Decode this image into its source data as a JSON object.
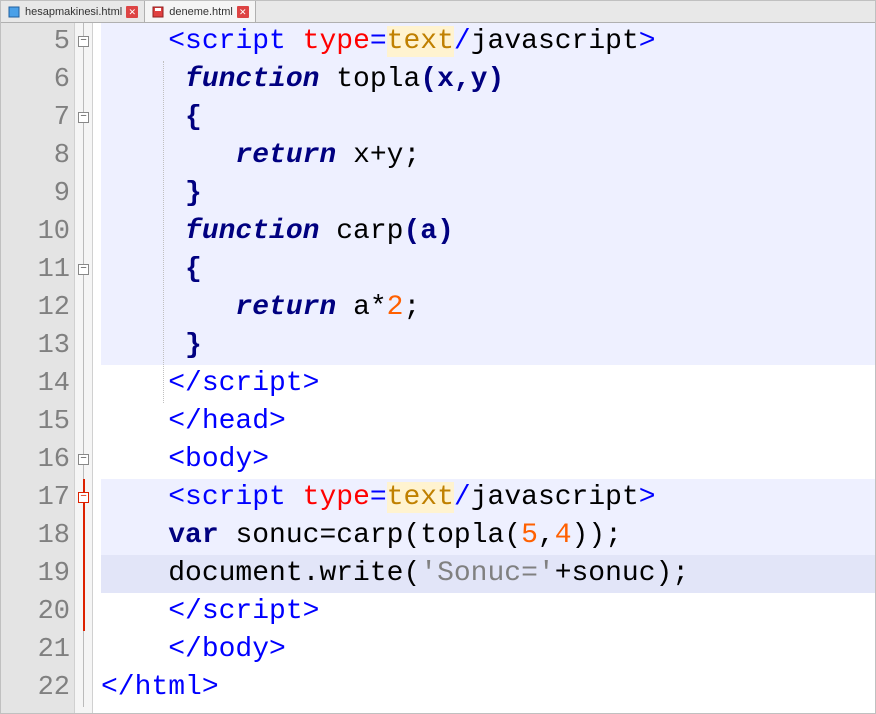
{
  "tabs": [
    {
      "label": "hesapmakinesi.html",
      "active": false,
      "icon": "file-blue"
    },
    {
      "label": "deneme.html",
      "active": true,
      "icon": "file-red"
    }
  ],
  "line_numbers": [
    "5",
    "6",
    "7",
    "8",
    "9",
    "10",
    "11",
    "12",
    "13",
    "14",
    "15",
    "16",
    "17",
    "18",
    "19",
    "20",
    "21",
    "22"
  ],
  "fold_marks": [
    {
      "row": 0,
      "sym": "−"
    },
    {
      "row": 2,
      "sym": "−"
    },
    {
      "row": 6,
      "sym": "−"
    },
    {
      "row": 11,
      "sym": "−"
    },
    {
      "row": 12,
      "sym": "−"
    }
  ],
  "code": {
    "l5": {
      "indent": "    ",
      "open1": "<",
      "tag": "script",
      "sp": " ",
      "attr": "type",
      "eq": "=",
      "val": "text",
      "slash": "/",
      "suffix": "javascript",
      "close": ">"
    },
    "l6": {
      "indent": "     ",
      "kw": "function",
      "sp": " ",
      "name": "topla",
      "paren": "(x,y)"
    },
    "l7": {
      "indent": "     ",
      "brace": "{"
    },
    "l8": {
      "indent": "        ",
      "kw": "return",
      "sp": " ",
      "expr": "x+y;"
    },
    "l9": {
      "indent": "     ",
      "brace": "}"
    },
    "l10": {
      "indent": "     ",
      "kw": "function",
      "sp": " ",
      "name": "carp",
      "paren": "(a)"
    },
    "l11": {
      "indent": "     ",
      "brace": "{"
    },
    "l12": {
      "indent": "        ",
      "kw": "return",
      "sp": " ",
      "pre": "a*",
      "num": "2",
      "post": ";"
    },
    "l13": {
      "indent": "     ",
      "brace": "}"
    },
    "l14": {
      "indent": "    ",
      "open": "</",
      "tag": "script",
      "close": ">"
    },
    "l15": {
      "indent": "    ",
      "open": "</",
      "tag": "head",
      "close": ">"
    },
    "l16": {
      "indent": "    ",
      "open": "<",
      "tag": "body",
      "close": ">"
    },
    "l17": {
      "indent": "    ",
      "open1": "<",
      "tag": "script",
      "sp": " ",
      "attr": "type",
      "eq": "=",
      "val": "text",
      "slash": "/",
      "suffix": "javascript",
      "close": ">"
    },
    "l18": {
      "indent": "    ",
      "kw": "var",
      "sp": " ",
      "expr": "sonuc=carp(topla(",
      "n1": "5",
      "comma": ",",
      "n2": "4",
      "end": "));"
    },
    "l19": {
      "indent": "    ",
      "pre": "document.write(",
      "str": "'Sonuc='",
      "post": "+sonuc);"
    },
    "l20": {
      "indent": "    ",
      "open": "</",
      "tag": "script",
      "close": ">"
    },
    "l21": {
      "indent": "    ",
      "open": "</",
      "tag": "body",
      "close": ">"
    },
    "l22": {
      "indent": "",
      "open": "</",
      "tag": "html",
      "close": ">"
    }
  }
}
